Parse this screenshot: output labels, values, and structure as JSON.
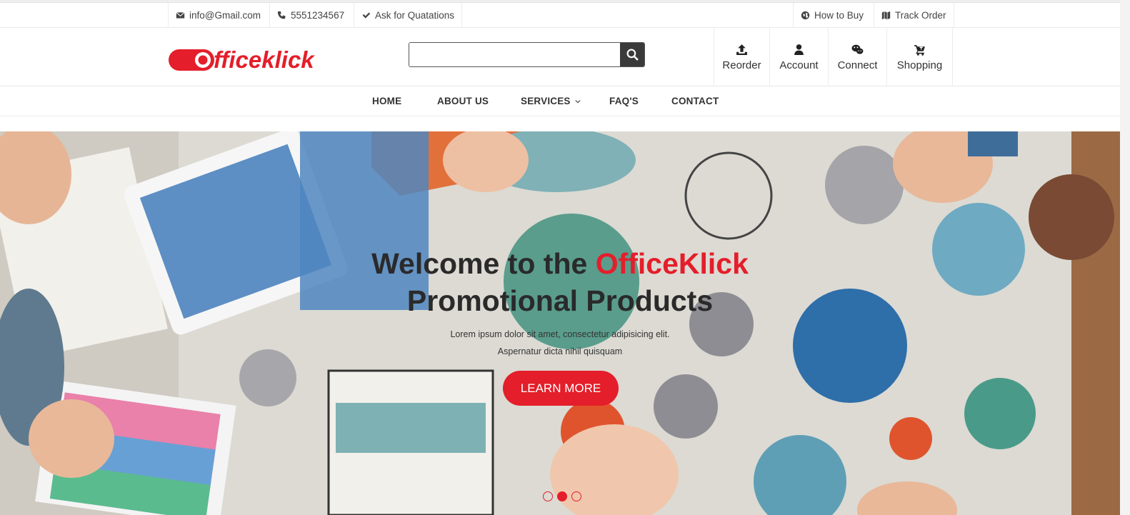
{
  "topbar": {
    "email": "info@Gmail.com",
    "phone": "5551234567",
    "quote": "Ask for Quatations",
    "how_to_buy": "How to Buy",
    "track_order": "Track Order"
  },
  "brand": {
    "logo_text": "fficeklick",
    "accent": "#e41e2a"
  },
  "search": {
    "placeholder": "",
    "value": ""
  },
  "header_icons": [
    {
      "label": "Reorder",
      "icon": "upload-icon"
    },
    {
      "label": "Account",
      "icon": "user-icon"
    },
    {
      "label": "Connect",
      "icon": "wechat-icon"
    },
    {
      "label": "Shopping",
      "icon": "cart-icon"
    }
  ],
  "nav": {
    "items": [
      "HOME",
      "ABOUT US",
      "SERVICES",
      "FAQ'S",
      "CONTACT"
    ]
  },
  "hero": {
    "title_part1": "Welcome to the",
    "title_accent": "OfficeKlick",
    "title_line2": "Promotional Products",
    "subtitle_line1": "Lorem ipsum dolor sit amet, consectetur adipisicing elit.",
    "subtitle_line2": "Aspernatur dicta nihil quisquam",
    "cta": "LEARN MORE",
    "active_slide": 2,
    "slide_count": 3
  }
}
